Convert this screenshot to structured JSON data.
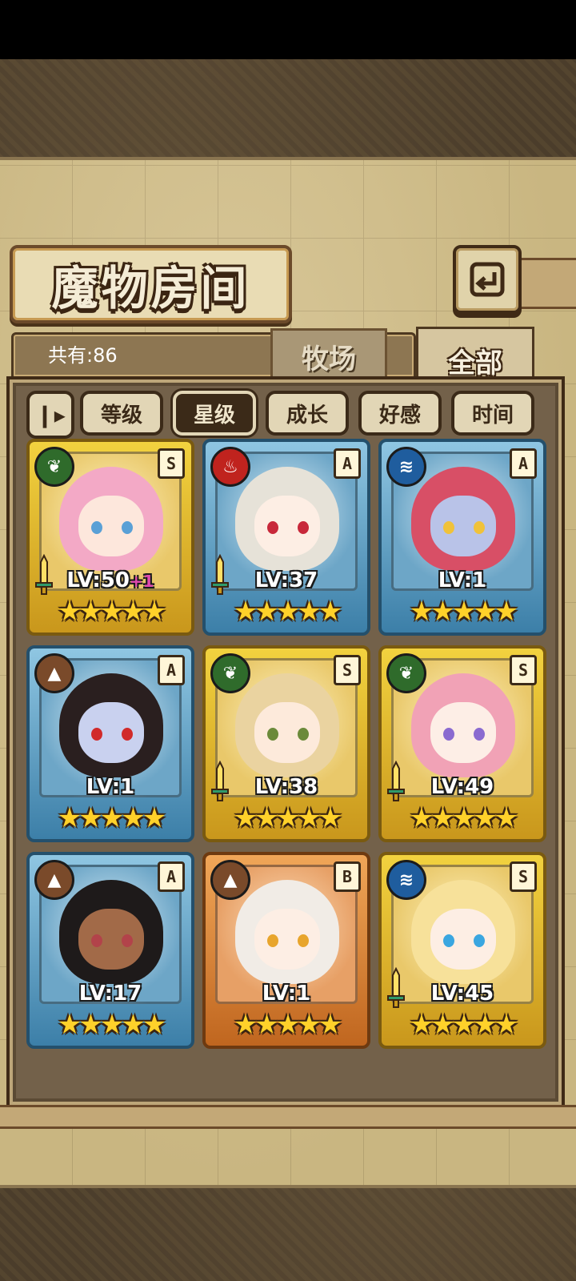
{
  "title": "魔物房间",
  "count_label": "共有:86",
  "tabs": [
    {
      "label": "牧场",
      "active": false
    },
    {
      "label": "全部",
      "active": true
    }
  ],
  "sort_toggle_icon": "sort-toggle-icon",
  "sort_options": [
    {
      "label": "等级",
      "active": false
    },
    {
      "label": "星级",
      "active": true
    },
    {
      "label": "成长",
      "active": false
    },
    {
      "label": "好感",
      "active": false
    },
    {
      "label": "时间",
      "active": false
    }
  ],
  "monsters": [
    {
      "element": "grass",
      "element_icon": "leaf-icon",
      "rank": "S",
      "level": "LV:50",
      "level_bonus": "+1",
      "has_weapon": true,
      "stars": 5,
      "hair": "#f3a9c6",
      "skin": "#fde7dc",
      "eye": "#5aa0d6"
    },
    {
      "element": "fire",
      "element_icon": "flame-icon",
      "rank": "A",
      "level": "LV:37",
      "level_bonus": "",
      "has_weapon": true,
      "stars": 5,
      "hair": "#e6e2d8",
      "skin": "#fdeee4",
      "eye": "#c8283a"
    },
    {
      "element": "water",
      "element_icon": "wave-icon",
      "rank": "A",
      "level": "LV:1",
      "level_bonus": "",
      "has_weapon": false,
      "stars": 5,
      "hair": "#d84f66",
      "skin": "#b9c3e8",
      "eye": "#f0c23a"
    },
    {
      "element": "earth",
      "element_icon": "mountain-icon",
      "rank": "A",
      "level": "LV:1",
      "level_bonus": "",
      "has_weapon": false,
      "stars": 5,
      "hair": "#2a1f1f",
      "skin": "#c9d1ef",
      "eye": "#d12a2a"
    },
    {
      "element": "grass",
      "element_icon": "leaf-icon",
      "rank": "S",
      "level": "LV:38",
      "level_bonus": "",
      "has_weapon": true,
      "stars": 5,
      "hair": "#ead3a0",
      "skin": "#fdeadb",
      "eye": "#6b8a3a"
    },
    {
      "element": "grass",
      "element_icon": "leaf-icon",
      "rank": "S",
      "level": "LV:49",
      "level_bonus": "",
      "has_weapon": true,
      "stars": 5,
      "hair": "#f1a2b6",
      "skin": "#fdeee6",
      "eye": "#8a6ad0"
    },
    {
      "element": "earth",
      "element_icon": "mountain-icon",
      "rank": "A",
      "level": "LV:17",
      "level_bonus": "",
      "has_weapon": false,
      "stars": 5,
      "hair": "#1e1a1a",
      "skin": "#a26a48",
      "eye": "#b2434a"
    },
    {
      "element": "earth",
      "element_icon": "mountain-icon",
      "rank": "B",
      "level": "LV:1",
      "level_bonus": "",
      "has_weapon": false,
      "stars": 5,
      "hair": "#f1ece6",
      "skin": "#fdeee4",
      "eye": "#e8a52c"
    },
    {
      "element": "water",
      "element_icon": "wave-icon",
      "rank": "S",
      "level": "LV:45",
      "level_bonus": "",
      "has_weapon": true,
      "stars": 5,
      "hair": "#f7e19a",
      "skin": "#fdeee4",
      "eye": "#3aa6e0"
    }
  ]
}
